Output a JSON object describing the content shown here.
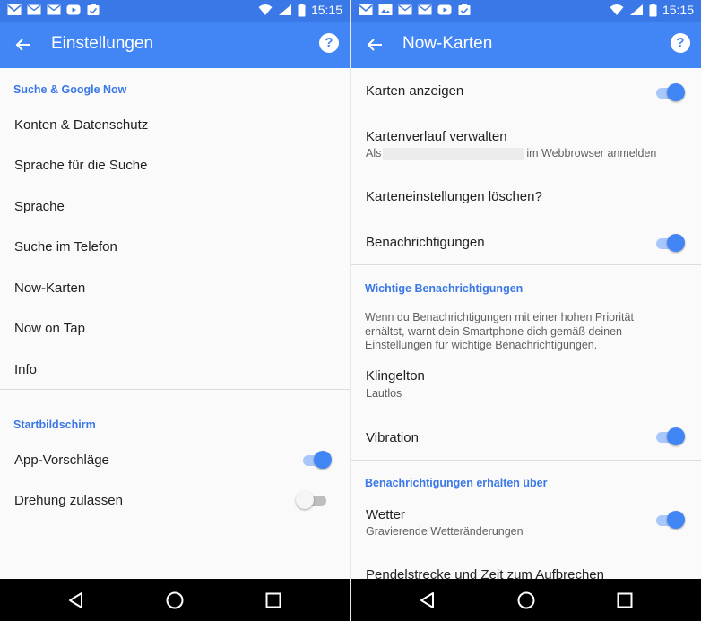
{
  "status_bar": {
    "time": "15:15"
  },
  "left": {
    "title": "Einstellungen",
    "sections": {
      "search": {
        "header": "Suche & Google Now",
        "items": [
          "Konten & Datenschutz",
          "Sprache für die Suche",
          "Sprache",
          "Suche im Telefon",
          "Now-Karten",
          "Now on Tap",
          "Info"
        ]
      },
      "home": {
        "header": "Startbildschirm",
        "app_suggestions": {
          "label": "App-Vorschläge",
          "enabled": true
        },
        "rotation": {
          "label": "Drehung zulassen",
          "enabled": false
        }
      }
    }
  },
  "right": {
    "title": "Now-Karten",
    "show_cards": {
      "label": "Karten anzeigen",
      "enabled": true
    },
    "history": {
      "label": "Kartenverlauf verwalten",
      "sub_prefix": "Als",
      "sub_suffix": "im Webbrowser anmelden"
    },
    "delete_settings": {
      "label": "Karteneinstellungen löschen?"
    },
    "notifications": {
      "label": "Benachrichtigungen",
      "enabled": true
    },
    "important": {
      "header": "Wichtige Benachrichtigungen",
      "description": "Wenn du Benachrichtigungen mit einer hohen Priorität erhältst, warnt dein Smartphone dich gemäß deinen Einstellungen für wichtige Benachrichtigungen.",
      "ringtone": {
        "label": "Klingelton",
        "value": "Lautlos"
      },
      "vibration": {
        "label": "Vibration",
        "enabled": true
      }
    },
    "receive": {
      "header": "Benachrichtigungen erhalten über",
      "weather": {
        "label": "Wetter",
        "sub": "Gravierende Wetteränderungen",
        "enabled": true
      },
      "commute": {
        "label": "Pendelstrecke und Zeit zum Aufbrechen"
      }
    }
  },
  "colors": {
    "accent": "#4285f4",
    "status_bar": "#3b78e7",
    "section_header": "#3b78e7",
    "toggle_track_on": "#a8c7fa"
  },
  "icons": [
    "gmail-icon",
    "mail-icon",
    "youtube-icon",
    "tasks-icon",
    "wifi-icon",
    "signal-icon",
    "battery-icon",
    "back-arrow-icon",
    "help-icon",
    "nav-back-icon",
    "nav-home-icon",
    "nav-recents-icon"
  ]
}
